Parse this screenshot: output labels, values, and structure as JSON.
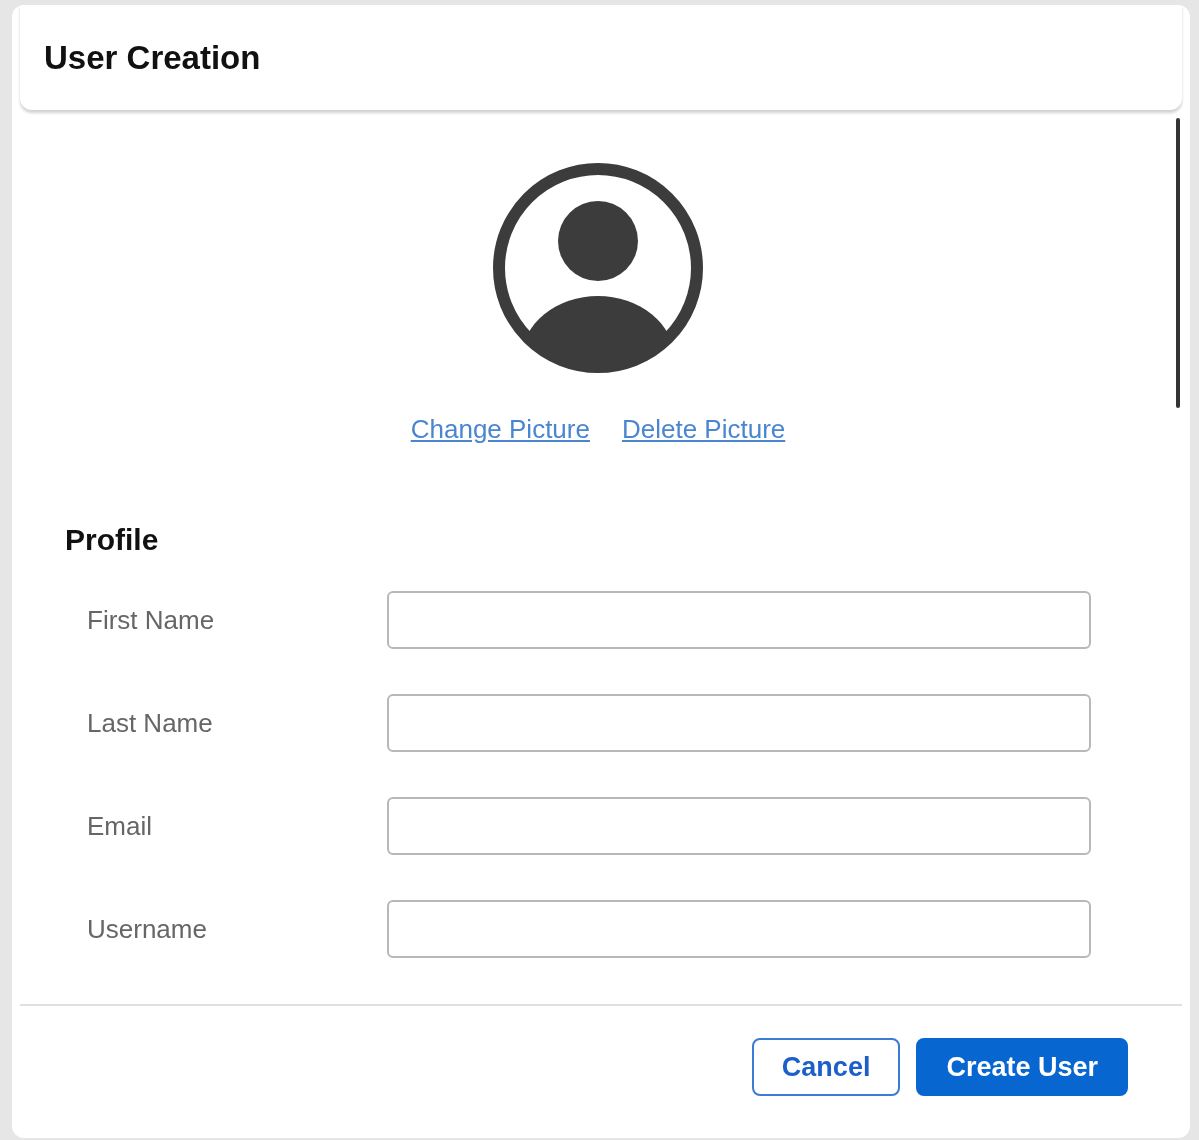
{
  "dialog": {
    "title": "User Creation"
  },
  "picture_links": [
    "Change Picture",
    "Delete Picture"
  ],
  "profile": {
    "heading": "Profile",
    "fields": [
      {
        "label": "First Name"
      },
      {
        "label": "Last Name"
      },
      {
        "label": "Email"
      },
      {
        "label": "Username"
      }
    ]
  },
  "buttons": [
    {
      "label": "Cancel",
      "kind": "secondary"
    },
    {
      "label": "Create User",
      "kind": "primary"
    }
  ]
}
